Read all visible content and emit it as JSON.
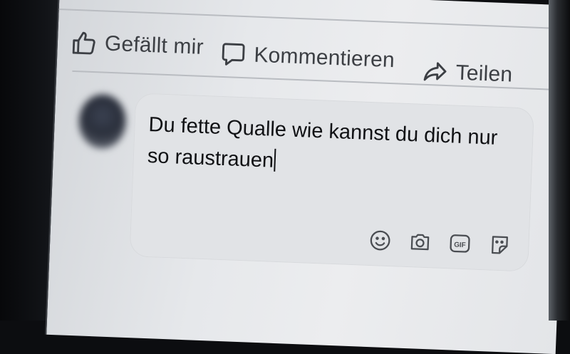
{
  "actions": {
    "like_label": "Gefällt mir",
    "comment_label": "Kommentieren",
    "share_label": "Teilen"
  },
  "comment": {
    "line1": "Du fette Qualle wie kannst du dich nur",
    "line2": "so raustrauen"
  },
  "icons": [
    "thumbs-up-icon",
    "comment-bubble-icon",
    "share-arrow-icon",
    "emoji-icon",
    "camera-icon",
    "gif-icon",
    "sticker-icon"
  ],
  "colors": {
    "text": "#101114",
    "muted": "#3c3f44",
    "surface": "#ecedef",
    "field": "#e1e3e6"
  }
}
